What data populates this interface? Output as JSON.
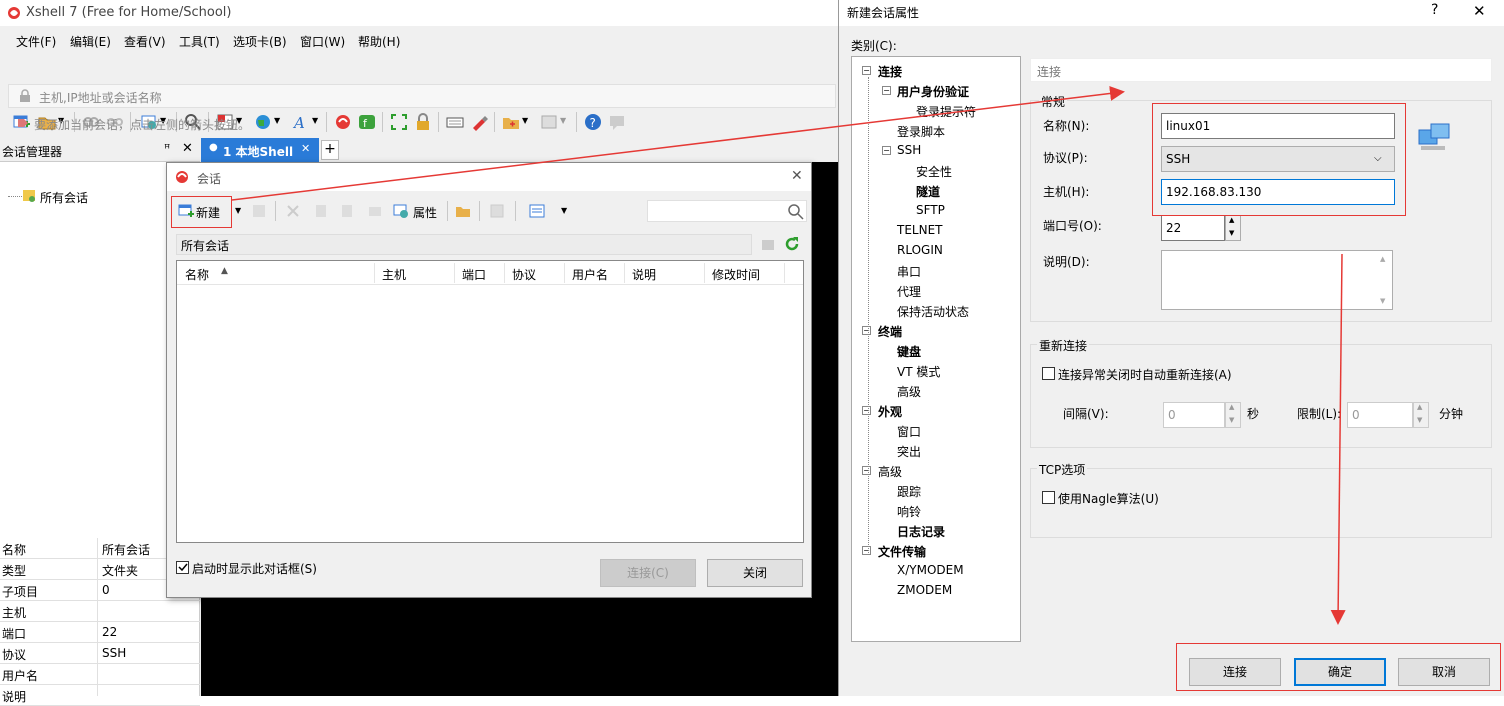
{
  "main": {
    "title": "Xshell 7 (Free for Home/School)",
    "menu": [
      "文件(F)",
      "编辑(E)",
      "查看(V)",
      "工具(T)",
      "选项卡(B)",
      "窗口(W)",
      "帮助(H)"
    ],
    "address_placeholder": "主机,IP地址或会话名称",
    "hint": "要添加当前会话，点击左侧的箭头按钮。",
    "session_manager_title": "会话管理器",
    "tab_label": "1 本地Shell",
    "tree_root": "所有会话",
    "props": [
      {
        "k": "名称",
        "v": "所有会话"
      },
      {
        "k": "类型",
        "v": "文件夹"
      },
      {
        "k": "子项目",
        "v": "0"
      },
      {
        "k": "主机",
        "v": ""
      },
      {
        "k": "端口",
        "v": "22"
      },
      {
        "k": "协议",
        "v": "SSH"
      },
      {
        "k": "用户名",
        "v": ""
      },
      {
        "k": "说明",
        "v": ""
      }
    ]
  },
  "sessions_dialog": {
    "title": "会话",
    "new_label": "新建",
    "props_label": "属性",
    "path": "所有会话",
    "columns": [
      "名称",
      "主机",
      "端口",
      "协议",
      "用户名",
      "说明",
      "修改时间"
    ],
    "startup_checkbox": "启动时显示此对话框(S)",
    "connect_label": "连接(C)",
    "close_label": "关闭"
  },
  "props_dialog": {
    "title": "新建会话属性",
    "help": "?",
    "category_label": "类别(C):",
    "tree": [
      {
        "label": "连接",
        "level": 0,
        "bold": true,
        "expander": "minus"
      },
      {
        "label": "用户身份验证",
        "level": 1,
        "bold": true,
        "expander": "minus"
      },
      {
        "label": "登录提示符",
        "level": 2,
        "bold": false,
        "expander": ""
      },
      {
        "label": "登录脚本",
        "level": 1,
        "bold": false,
        "expander": ""
      },
      {
        "label": "SSH",
        "level": 1,
        "bold": false,
        "expander": "minus"
      },
      {
        "label": "安全性",
        "level": 2,
        "bold": false,
        "expander": ""
      },
      {
        "label": "隧道",
        "level": 2,
        "bold": true,
        "expander": ""
      },
      {
        "label": "SFTP",
        "level": 2,
        "bold": false,
        "expander": ""
      },
      {
        "label": "TELNET",
        "level": 1,
        "bold": false,
        "expander": ""
      },
      {
        "label": "RLOGIN",
        "level": 1,
        "bold": false,
        "expander": ""
      },
      {
        "label": "串口",
        "level": 1,
        "bold": false,
        "expander": ""
      },
      {
        "label": "代理",
        "level": 1,
        "bold": false,
        "expander": ""
      },
      {
        "label": "保持活动状态",
        "level": 1,
        "bold": false,
        "expander": ""
      },
      {
        "label": "终端",
        "level": 0,
        "bold": true,
        "expander": "minus"
      },
      {
        "label": "键盘",
        "level": 1,
        "bold": true,
        "expander": ""
      },
      {
        "label": "VT 模式",
        "level": 1,
        "bold": false,
        "expander": ""
      },
      {
        "label": "高级",
        "level": 1,
        "bold": false,
        "expander": ""
      },
      {
        "label": "外观",
        "level": 0,
        "bold": true,
        "expander": "minus"
      },
      {
        "label": "窗口",
        "level": 1,
        "bold": false,
        "expander": ""
      },
      {
        "label": "突出",
        "level": 1,
        "bold": false,
        "expander": ""
      },
      {
        "label": "高级",
        "level": 0,
        "bold": false,
        "expander": "minus"
      },
      {
        "label": "跟踪",
        "level": 1,
        "bold": false,
        "expander": ""
      },
      {
        "label": "响铃",
        "level": 1,
        "bold": false,
        "expander": ""
      },
      {
        "label": "日志记录",
        "level": 1,
        "bold": true,
        "expander": ""
      },
      {
        "label": "文件传输",
        "level": 0,
        "bold": true,
        "expander": "minus"
      },
      {
        "label": "X/YMODEM",
        "level": 1,
        "bold": false,
        "expander": ""
      },
      {
        "label": "ZMODEM",
        "level": 1,
        "bold": false,
        "expander": ""
      }
    ],
    "section_header": "连接",
    "general_group": "常规",
    "name_label": "名称(N):",
    "name_value": "linux01",
    "protocol_label": "协议(P):",
    "protocol_value": "SSH",
    "host_label": "主机(H):",
    "host_value": "192.168.83.130",
    "port_label": "端口号(O):",
    "port_value": "22",
    "desc_label": "说明(D):",
    "reconnect_group": "重新连接",
    "reconnect_checkbox": "连接异常关闭时自动重新连接(A)",
    "interval_label": "间隔(V):",
    "interval_value": "0",
    "seconds_label": "秒",
    "limit_label": "限制(L):",
    "limit_value": "0",
    "minutes_label": "分钟",
    "tcp_group": "TCP选项",
    "nagle_checkbox": "使用Nagle算法(U)",
    "connect_btn": "连接",
    "ok_btn": "确定",
    "cancel_btn": "取消"
  },
  "colors": {
    "accent_red": "#e53935",
    "tab_blue": "#2a7bd8",
    "ok_border": "#0078d7"
  }
}
